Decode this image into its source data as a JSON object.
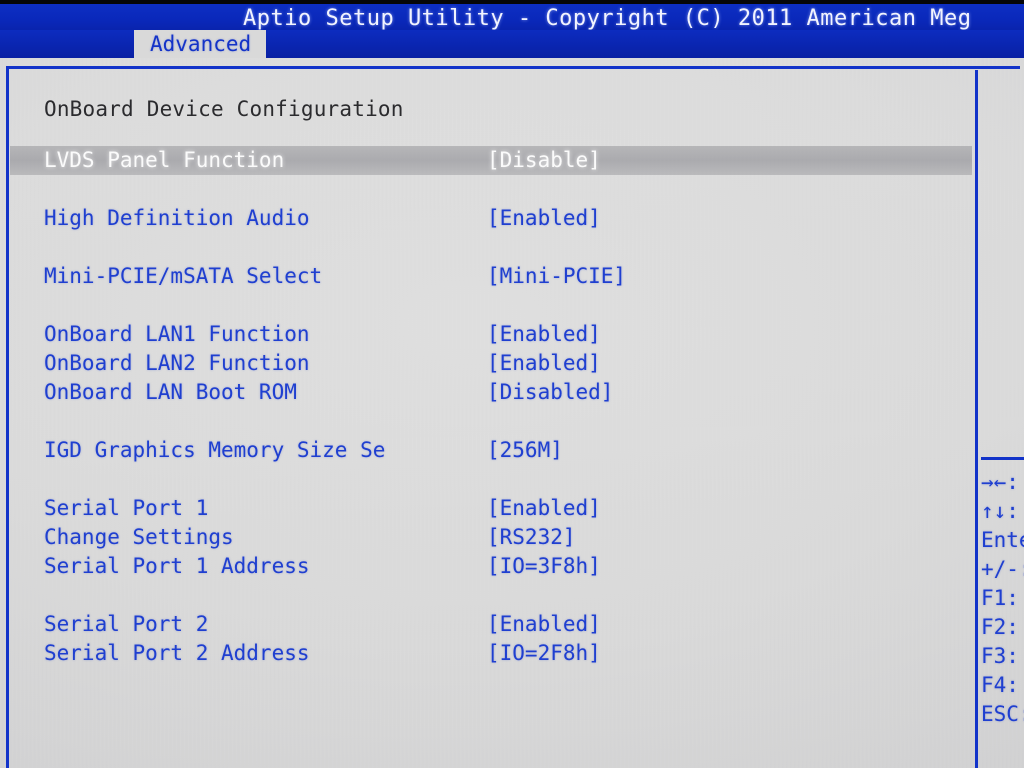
{
  "window": {
    "title": "Aptio Setup Utility - Copyright (C) 2011 American Meg",
    "title_full_visible": "Aptio Setup Utility - Copyright (C) 2011 American Meg"
  },
  "tabs": [
    {
      "label": "Advanced",
      "active": true
    }
  ],
  "colors": {
    "header_blue": "#0a28ba",
    "frame_blue": "#1233c9",
    "text_blue": "#1f3fd0",
    "selected_text": "#fbfbfb",
    "section_title": "#2b2b2e",
    "screen_bg": "#d8d8d9"
  },
  "main": {
    "section_title": "OnBoard Device Configuration",
    "rows": [
      {
        "label": "LVDS Panel Function",
        "value": "[Disable]",
        "selected": true,
        "gap_before": false
      },
      {
        "label": "High Definition Audio",
        "value": "[Enabled]",
        "selected": false,
        "gap_before": true
      },
      {
        "label": "Mini-PCIE/mSATA Select",
        "value": "[Mini-PCIE]",
        "selected": false,
        "gap_before": true
      },
      {
        "label": "OnBoard LAN1 Function",
        "value": "[Enabled]",
        "selected": false,
        "gap_before": true
      },
      {
        "label": "OnBoard LAN2 Function",
        "value": "[Enabled]",
        "selected": false,
        "gap_before": false
      },
      {
        "label": "OnBoard LAN Boot ROM",
        "value": "[Disabled]",
        "selected": false,
        "gap_before": false
      },
      {
        "label": "IGD Graphics Memory Size Se",
        "value": "[256M]",
        "selected": false,
        "gap_before": true
      },
      {
        "label": "Serial Port 1",
        "value": "[Enabled]",
        "selected": false,
        "gap_before": true
      },
      {
        "label": "Change Settings",
        "value": "[RS232]",
        "selected": false,
        "gap_before": false
      },
      {
        "label": "Serial Port 1 Address",
        "value": "[IO=3F8h]",
        "selected": false,
        "gap_before": false
      },
      {
        "label": "Serial Port 2",
        "value": "[Enabled]",
        "selected": false,
        "gap_before": true
      },
      {
        "label": "Serial Port 2 Address",
        "value": "[IO=2F8h]",
        "selected": false,
        "gap_before": false
      }
    ]
  },
  "help": {
    "keys": [
      {
        "glyph": "→←:",
        "name": "left-right-arrow-key"
      },
      {
        "glyph": "↑↓:",
        "name": "up-down-arrow-key"
      },
      {
        "glyph": "Ente",
        "name": "enter-key"
      },
      {
        "glyph": "+/-:",
        "name": "plus-minus-key"
      },
      {
        "glyph": "F1:",
        "name": "f1-key"
      },
      {
        "glyph": "F2:",
        "name": "f2-key"
      },
      {
        "glyph": "F3:",
        "name": "f3-key"
      },
      {
        "glyph": "F4:",
        "name": "f4-key"
      },
      {
        "glyph": "ESC:",
        "name": "esc-key"
      }
    ]
  }
}
